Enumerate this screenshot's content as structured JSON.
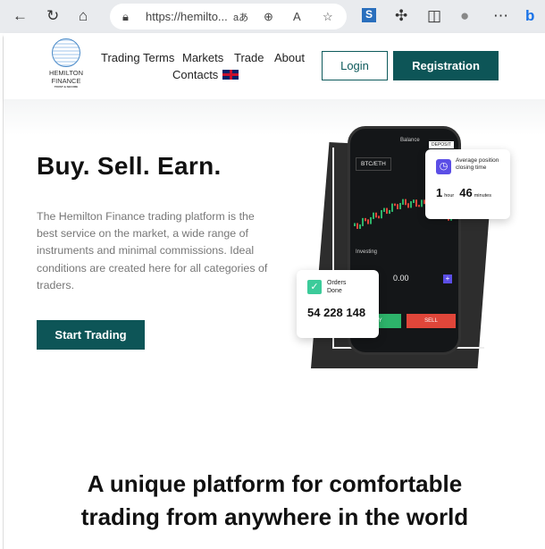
{
  "browser": {
    "url": "https://hemilto...",
    "icons": [
      "back-icon",
      "refresh-icon",
      "home-icon",
      "lock-icon",
      "translate-icon",
      "zoom-icon",
      "read-aloud-icon",
      "favorite-icon",
      "s-extension-icon",
      "extensions-icon",
      "split-screen-icon",
      "profile-icon",
      "more-icon",
      "bing-icon"
    ]
  },
  "header": {
    "logo_name": "HEMILTON",
    "logo_sub": "FINANCE",
    "logo_tag": "TRUST & SECURE",
    "nav": [
      "Trading Terms",
      "Markets",
      "Trade",
      "About",
      "Contacts"
    ],
    "login": "Login",
    "register": "Registration"
  },
  "hero": {
    "title": "Buy. Sell. Earn.",
    "description": "The Hemilton Finance trading platform is the best service on the market, a wide range of instruments and minimal commissions. Ideal conditions are created here for all categories of traders.",
    "cta": "Start Trading"
  },
  "phone": {
    "pair": "BTC/ETH",
    "deposit": "DEPOSIT",
    "balance": "Balance",
    "section": "Investing",
    "amount": "0.00",
    "buy": "BUY",
    "sell": "SELL"
  },
  "cards": {
    "avg_title": "Average position closing time",
    "hours": "1",
    "hours_unit": "hour",
    "minutes": "46",
    "minutes_unit": "minutes",
    "orders_title": "Orders Done",
    "orders_value": "54 228 148"
  },
  "section2": {
    "line1": "A unique platform for comfortable",
    "line2": "trading from anywhere in the world"
  },
  "colors": {
    "primary": "#0d5557",
    "buy": "#2db36a",
    "sell": "#e0463a",
    "accent": "#5b4ee6"
  }
}
